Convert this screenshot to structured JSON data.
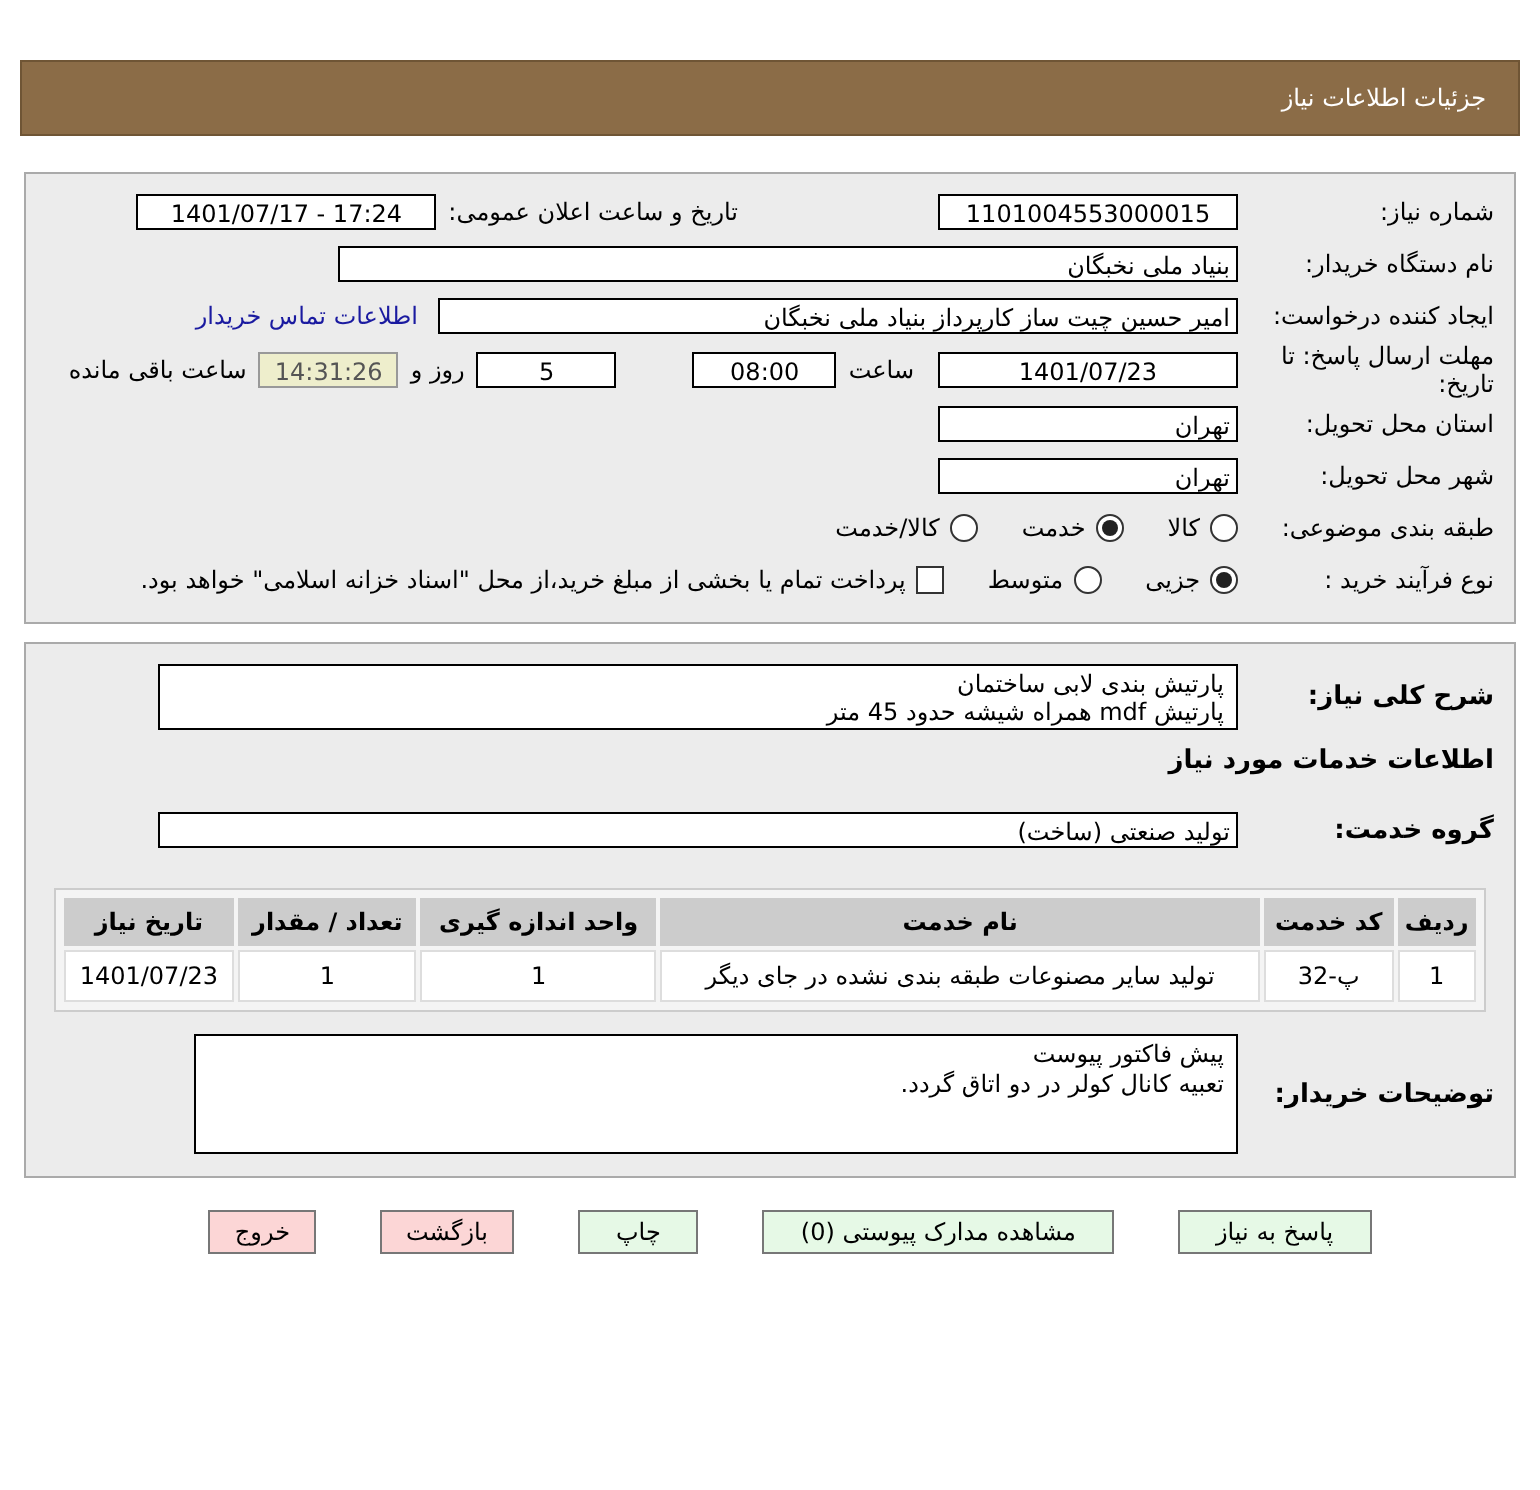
{
  "header": {
    "title": "جزئیات اطلاعات نیاز"
  },
  "need_number": {
    "label": "شماره نیاز:",
    "value": "1101004553000015"
  },
  "announce": {
    "label": "تاریخ و ساعت اعلان عمومی:",
    "value": "1401/07/17 - 17:24"
  },
  "buyer_org": {
    "label": "نام دستگاه خریدار:",
    "value": "بنیاد ملی نخبگان"
  },
  "requester": {
    "label": "ایجاد کننده درخواست:",
    "value": "امیر حسین چیت ساز کارپرداز بنیاد ملی نخبگان",
    "link": "اطلاعات تماس خریدار"
  },
  "deadline": {
    "label": "مهلت ارسال پاسخ: تا تاریخ:",
    "date": "1401/07/23",
    "time_label": "ساعت",
    "time": "08:00",
    "days": "5",
    "days_label": "روز و",
    "remaining": "14:31:26",
    "remaining_label": "ساعت باقی مانده"
  },
  "province": {
    "label": "استان محل تحویل:",
    "value": "تهران"
  },
  "city": {
    "label": "شهر محل تحویل:",
    "value": "تهران"
  },
  "category": {
    "label": "طبقه بندی موضوعی:",
    "options": [
      {
        "label": "کالا",
        "selected": false
      },
      {
        "label": "خدمت",
        "selected": true
      },
      {
        "label": "کالا/خدمت",
        "selected": false
      }
    ]
  },
  "process": {
    "label": "نوع فرآیند خرید :",
    "options": [
      {
        "label": "جزیی",
        "selected": true
      },
      {
        "label": "متوسط",
        "selected": false
      }
    ],
    "payment": {
      "checked": false,
      "text": "پرداخت تمام یا بخشی از مبلغ خرید،از محل \"اسناد خزانه اسلامی\" خواهد بود."
    }
  },
  "description": {
    "label": "شرح کلی نیاز:",
    "lines": [
      "پارتیش بندی لابی ساختمان",
      "پارتیش mdf همراه شیشه حدود 45 متر"
    ]
  },
  "services": {
    "heading": "اطلاعات خدمات مورد نیاز",
    "group_label": "گروه خدمت:",
    "group_value": "تولید صنعتی (ساخت)"
  },
  "table": {
    "columns": [
      "ردیف",
      "کد خدمت",
      "نام خدمت",
      "واحد اندازه گیری",
      "تعداد / مقدار",
      "تاریخ نیاز"
    ],
    "rows": [
      [
        "1",
        "پ-32",
        "تولید سایر مصنوعات طبقه بندی نشده در جای دیگر",
        "1",
        "1",
        "1401/07/23"
      ]
    ]
  },
  "buyer_notes": {
    "label": "توضیحات خریدار:",
    "lines": [
      "پیش فاکتور پیوست",
      "تعبیه کانال کولر در دو اتاق گردد."
    ]
  },
  "buttons": [
    {
      "label": "پاسخ به نیاز",
      "kind": "normal"
    },
    {
      "label": "مشاهده مدارک پیوستی (0)",
      "kind": "normal"
    },
    {
      "label": "چاپ",
      "kind": "normal"
    },
    {
      "label": "بازگشت",
      "kind": "danger"
    },
    {
      "label": "خروج",
      "kind": "danger"
    }
  ]
}
